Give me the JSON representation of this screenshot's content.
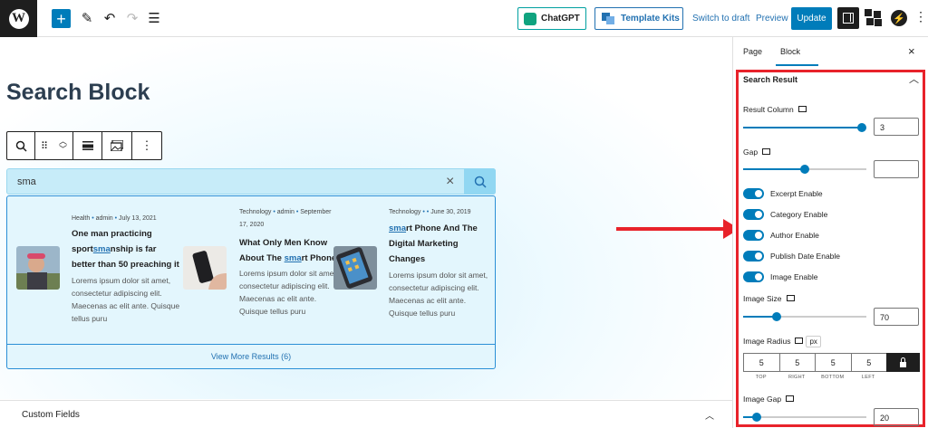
{
  "toolbar": {
    "wp_logo": "W",
    "add_label": "+",
    "chatgpt_label": "ChatGPT",
    "template_kits_label": "Template Kits",
    "switch_draft_label": "Switch to draft",
    "preview_label": "Preview",
    "update_label": "Update",
    "icons": [
      "add-icon",
      "pencil-icon",
      "undo-icon",
      "redo-icon",
      "list-view-icon",
      "sidebar-icon",
      "blocks-icon",
      "plugin-icon",
      "more-icon"
    ]
  },
  "editor": {
    "page_title": "Search Block",
    "search": {
      "value": "sma",
      "clear_glyph": "×"
    },
    "results": [
      {
        "meta_pre": "Health",
        "meta_author": "admin",
        "meta_date": "July 13, 2021",
        "title_before": "One man practicing sport",
        "title_highlight": "sma",
        "title_after": "nship is far better than 50 preaching it",
        "excerpt": "Lorems ipsum dolor sit amet, consectetur adipiscing elit. Maecenas ac elit ante. Quisque tellus puru"
      },
      {
        "meta_pre": "Technology",
        "meta_author": "admin",
        "meta_date": "September 17, 2020",
        "title_before": "What Only Men Know About The ",
        "title_highlight": "sma",
        "title_after": "rt Phone",
        "excerpt": "Lorems ipsum dolor sit amet, consectetur adipiscing elit. Maecenas ac elit ante. Quisque tellus puru"
      },
      {
        "meta_pre": "Technology",
        "meta_author": "",
        "meta_date": "June 30, 2019",
        "title_before": "",
        "title_highlight": "sma",
        "title_after": "rt Phone And The Digital Marketing Changes",
        "excerpt": "Lorems ipsum dolor sit amet, consectetur adipiscing elit. Maecenas ac elit ante. Quisque tellus puru"
      }
    ],
    "view_more_label": "View More Results (6)",
    "custom_fields_label": "Custom Fields"
  },
  "sidebar": {
    "tab_page": "Page",
    "tab_block": "Block",
    "close_glyph": "×",
    "section_title": "Search Result",
    "result_column_label": "Result Column",
    "result_column_value": "3",
    "result_column_fraction": 1.0,
    "gap_label": "Gap",
    "gap_value": "",
    "gap_fraction": 0.5,
    "toggles": [
      {
        "label": "Excerpt Enable",
        "on": true
      },
      {
        "label": "Category Enable",
        "on": true
      },
      {
        "label": "Author Enable",
        "on": true
      },
      {
        "label": "Publish Date Enable",
        "on": true
      },
      {
        "label": "Image Enable",
        "on": true
      }
    ],
    "image_size_label": "Image Size",
    "image_size_value": "70",
    "image_size_fraction": 0.25,
    "image_radius_label": "Image Radius",
    "image_radius_unit": "px",
    "radius": {
      "top": "5",
      "right": "5",
      "bottom": "5",
      "left": "5"
    },
    "radius_labels": {
      "top": "TOP",
      "right": "RIGHT",
      "bottom": "BOTTOM",
      "left": "LEFT"
    },
    "image_gap_label": "Image Gap",
    "image_gap_value": "20",
    "image_gap_fraction": 0.08
  },
  "colors": {
    "accent": "#007cba",
    "highlight_red": "#e8222a",
    "result_border": "#2a8fd6"
  }
}
